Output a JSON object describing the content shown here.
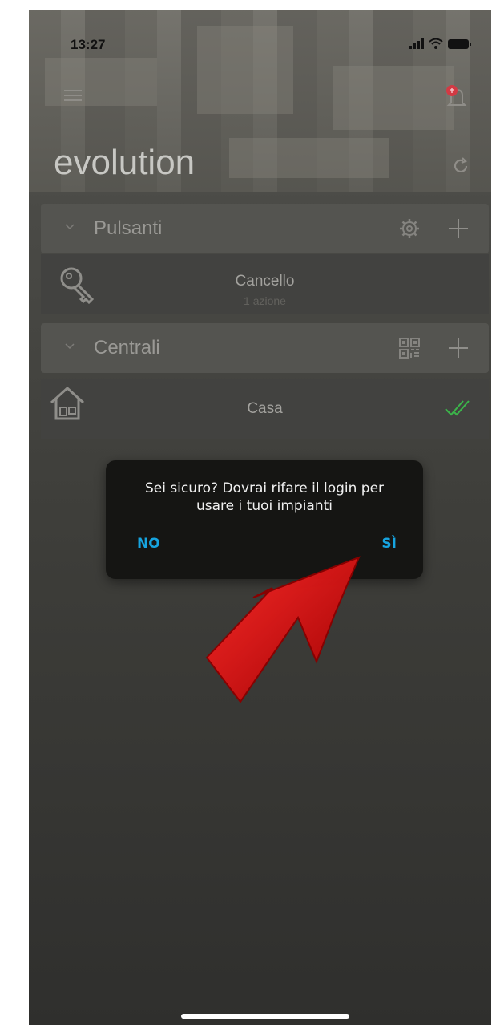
{
  "status_bar": {
    "time": "13:27"
  },
  "header": {
    "app_title": "evolution"
  },
  "sections": [
    {
      "label": "Pulsanti",
      "aux_icon": "gear-icon"
    },
    {
      "label": "Centrali",
      "aux_icon": "qr-code-icon"
    }
  ],
  "items": [
    {
      "title": "Cancello",
      "subtitle": "1 azione",
      "icon": "key-icon"
    },
    {
      "title": "Casa",
      "icon": "house-icon",
      "status_icon": "double-check-icon"
    }
  ],
  "dialog": {
    "message": "Sei sicuro? Dovrai rifare il login per usare i tuoi impianti",
    "no_label": "NO",
    "yes_label": "SÌ"
  },
  "colors": {
    "accent": "#16a4e0",
    "annotation_arrow": "#e30613",
    "check_green": "#3bb54a"
  }
}
